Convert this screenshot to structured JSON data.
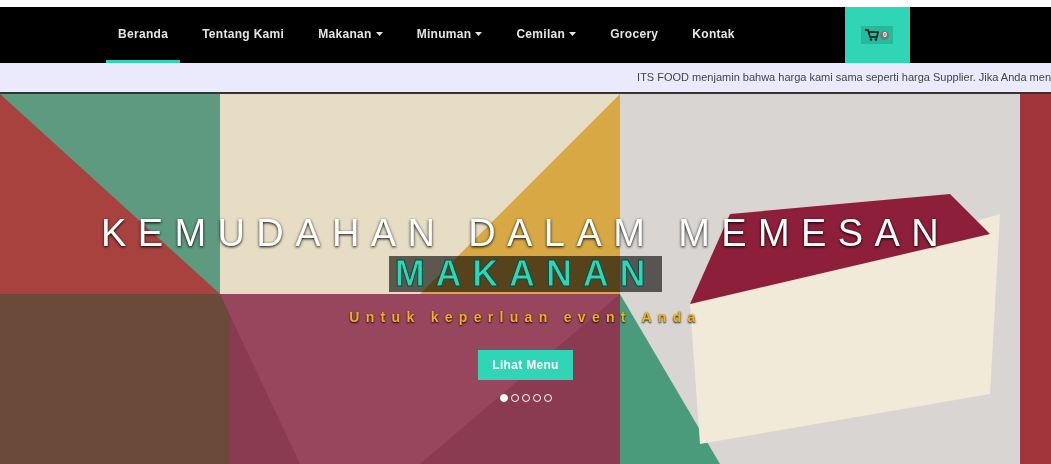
{
  "nav": {
    "items": [
      {
        "label": "Beranda",
        "selected": true,
        "dropdown": false
      },
      {
        "label": "Tentang Kami",
        "selected": false,
        "dropdown": false
      },
      {
        "label": "Makanan",
        "selected": false,
        "dropdown": true
      },
      {
        "label": "Minuman",
        "selected": false,
        "dropdown": true
      },
      {
        "label": "Cemilan",
        "selected": false,
        "dropdown": true
      },
      {
        "label": "Grocery",
        "selected": false,
        "dropdown": false
      },
      {
        "label": "Kontak",
        "selected": false,
        "dropdown": false
      }
    ],
    "cart": {
      "count": "0"
    }
  },
  "ticker": "ITS FOOD menjamin bahwa harga kami sama seperti harga Supplier. Jika Anda men",
  "hero": {
    "title": "KEMUDAHAN DALAM MEMESAN",
    "highlight": "MAKANAN",
    "subtitle": "Untuk keperluan event Anda",
    "button": "Lihat Menu",
    "dots": [
      {
        "selected": true
      },
      {
        "selected": false
      },
      {
        "selected": false
      },
      {
        "selected": false
      },
      {
        "selected": false
      }
    ]
  }
}
